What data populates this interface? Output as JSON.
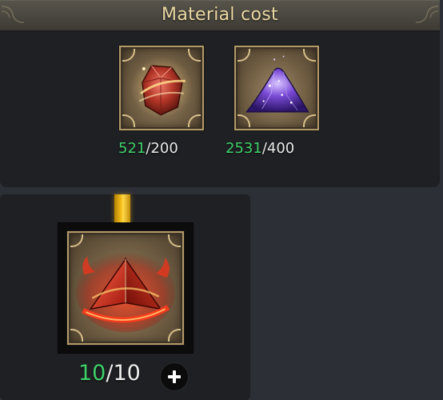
{
  "material_cost": {
    "title": "Material cost",
    "items": [
      {
        "icon": "red-stone-icon",
        "owned": "521",
        "required": "/200"
      },
      {
        "icon": "purple-crystal-pile-icon",
        "owned": "2531",
        "required": "/400"
      }
    ]
  },
  "target_item": {
    "icon": "flaming-red-pyramid-icon",
    "owned": "10",
    "required": "/10",
    "add_button_icon": "plus-icon"
  },
  "colors": {
    "owned_text": "#3fd06a",
    "title_text": "#ead8a4",
    "link_bar": "#f7c21d"
  }
}
